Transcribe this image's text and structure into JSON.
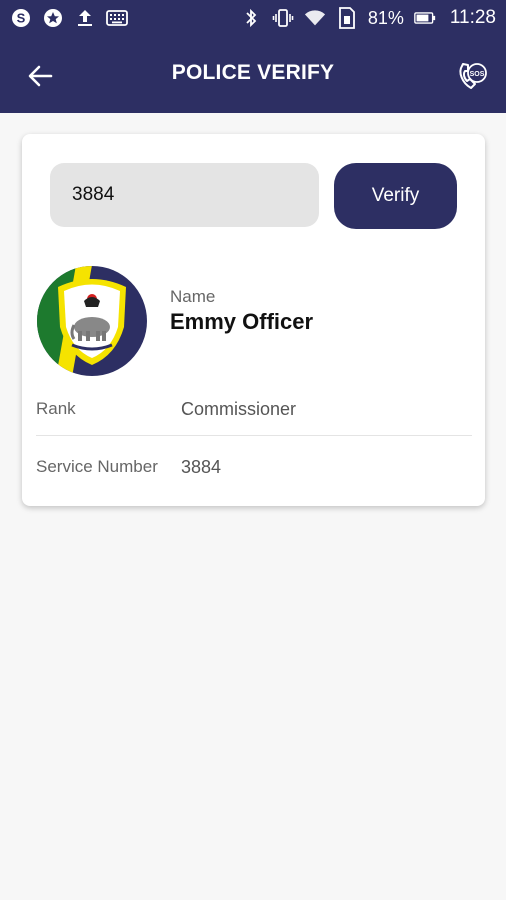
{
  "status_bar": {
    "icons_left": [
      "skype-icon",
      "star-badge-icon",
      "upload-icon",
      "keyboard-icon"
    ],
    "icons_right": [
      "bluetooth-icon",
      "vibrate-icon",
      "wifi-icon",
      "sim-icon"
    ],
    "battery": "81%",
    "time": "11:28"
  },
  "app_bar": {
    "title": "POLICE VERIFY",
    "back_icon": "arrow-left-icon",
    "sos_icon": "sos-phone-icon",
    "sos_label": "SOS"
  },
  "search": {
    "value": "3884",
    "button_label": "Verify"
  },
  "officer": {
    "name_label": "Name",
    "name": "Emmy Officer",
    "rank_label": "Rank",
    "rank": "Commissioner",
    "service_label": "Service Number",
    "service_number": "3884"
  },
  "colors": {
    "primary": "#2d2f63",
    "background": "#f7f7f7",
    "card": "#ffffff",
    "input_bg": "#e4e4e4"
  }
}
